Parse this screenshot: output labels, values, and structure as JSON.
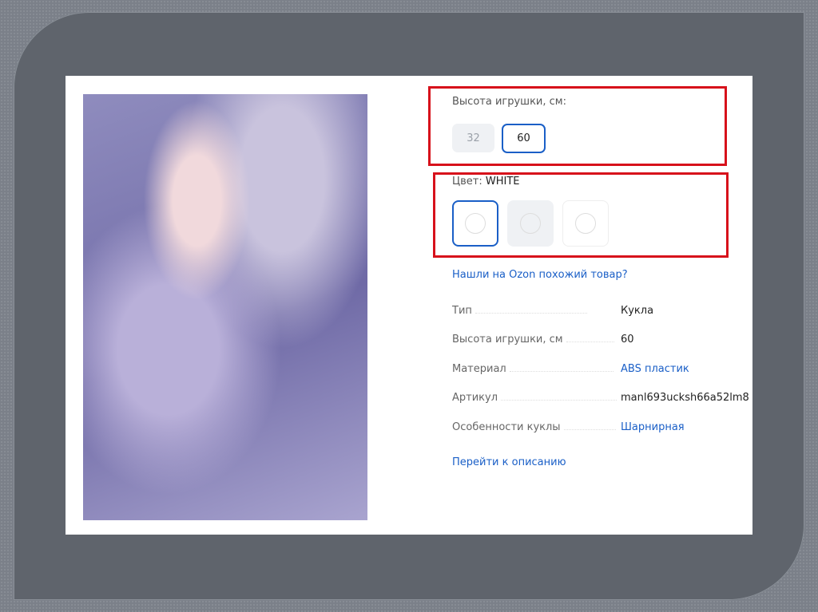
{
  "height_selector": {
    "label": "Высота игрушки, см:",
    "options": [
      "32",
      "60"
    ],
    "selected": "60"
  },
  "color_selector": {
    "label": "Цвет:",
    "value": "WHITE",
    "swatch_count": 3,
    "selected_index": 0
  },
  "similar_link": "Нашли на Ozon похожий товар?",
  "specs": [
    {
      "key": "Тип",
      "value": "Кукла",
      "link": false
    },
    {
      "key": "Высота игрушки, см",
      "value": "60",
      "link": false
    },
    {
      "key": "Материал",
      "value": "ABS пластик",
      "link": true
    },
    {
      "key": "Артикул",
      "value": "manl693ucksh66a52lm8",
      "link": false
    },
    {
      "key": "Особенности куклы",
      "value": "Шарнирная",
      "link": true
    }
  ],
  "description_link": "Перейти к описанию",
  "colors": {
    "highlight": "#d7111b",
    "accent": "#1a5fc7"
  }
}
